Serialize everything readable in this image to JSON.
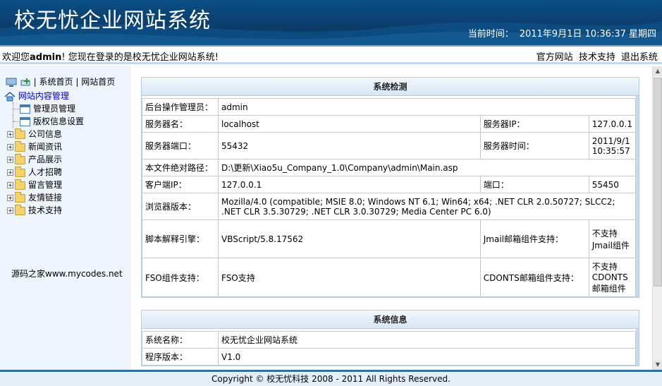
{
  "header": {
    "title": "校无忧企业网站系统",
    "clock_label": "当前时间：",
    "clock_value": "2011年9月1日 10:36:37 星期四"
  },
  "topbar": {
    "welcome_prefix": "欢迎您",
    "username": "admin",
    "welcome_suffix": "! 您现在登录的是校无忧企业网站系统!",
    "links": [
      "官方网站",
      "技术支持",
      "退出系统"
    ]
  },
  "sidebar": {
    "quick_links": [
      "系统首页",
      "网站首页"
    ],
    "quick_sep_left": "|",
    "quick_sep": "|",
    "root": "网站内容管理",
    "leaves": [
      "管理员管理",
      "版权信息设置"
    ],
    "folders": [
      "公司信息",
      "新闻资讯",
      "产品展示",
      "人才招聘",
      "留言管理",
      "友情链接",
      "技术支持"
    ],
    "credit": "源码之家www.mycodes.net"
  },
  "system_check": {
    "title": "系统检测",
    "admin_label": "后台操作管理员：",
    "admin_value": "admin",
    "server_name_label": "服务器名：",
    "server_name_value": "localhost",
    "server_ip_label": "服务器IP：",
    "server_ip_value": "127.0.0.1",
    "server_port_label": "服务器端口：",
    "server_port_value": "55432",
    "server_time_label": "服务器时间：",
    "server_time_value": "2011/9/1 10:35:57",
    "path_label": "本文件绝对路径：",
    "path_value": "D:\\更新\\Xiao5u_Company_1.0\\Company\\admin\\Main.asp",
    "client_ip_label": "客户端IP：",
    "client_ip_value": "127.0.0.1",
    "port_label": "端口：",
    "port_value": "55450",
    "browser_label": "浏览器版本：",
    "browser_value": "Mozilla/4.0 (compatible; MSIE 8.0; Windows NT 6.1; Win64; x64; .NET CLR 2.0.50727; SLCC2; .NET CLR 3.5.30729; .NET CLR 3.0.30729; Media Center PC 6.0)",
    "script_label": "脚本解释引擎：",
    "script_value": "VBScript/5.8.17562",
    "jmail_label": "Jmail邮箱组件支持：",
    "jmail_value": "不支持Jmail组件",
    "fso_label": "FSO组件支持：",
    "fso_value": "FSO支持",
    "cdonts_label": "CDONTS邮箱组件支持：",
    "cdonts_value": "不支持CDONTS邮箱组件"
  },
  "system_info": {
    "title": "系统信息",
    "name_label": "系统名称：",
    "name_value": "校无忧企业网站系统",
    "version_label": "程序版本：",
    "version_value": "V1.0"
  },
  "footer": {
    "copyright": "Copyright © 校无忧科技  2008 - 2011 All Rights Reserved."
  },
  "colors": {
    "header_bg": "#0b3e6b",
    "sidebar_bg": "#eef4fb",
    "border": "#b5cde3",
    "link": "#0000cc"
  }
}
